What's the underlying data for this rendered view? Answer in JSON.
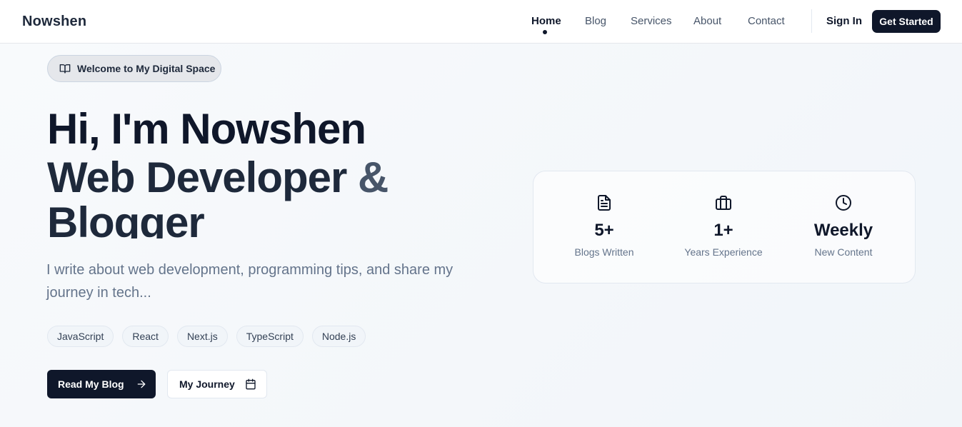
{
  "brand": "Nowshen",
  "nav": {
    "items": [
      {
        "label": "Home",
        "active": true
      },
      {
        "label": "Blog"
      },
      {
        "label": "Services"
      },
      {
        "label": "About"
      },
      {
        "label": "Contact"
      }
    ],
    "sign_in": "Sign In",
    "get_started": "Get Started"
  },
  "hero": {
    "badge": "Welcome to My Digital Space",
    "badge_icon": "book-open-icon",
    "line1": "Hi, I'm Nowshen",
    "line2_main": "Web Developer",
    "line2_amp": "&",
    "line3": "Blogger",
    "description": "I write about web development, programming tips, and share my journey in tech...",
    "tags": [
      "JavaScript",
      "React",
      "Next.js",
      "TypeScript",
      "Node.js"
    ],
    "primary_button": "Read My Blog",
    "primary_icon": "arrow-right-icon",
    "secondary_button": "My Journey",
    "secondary_icon": "calendar-icon"
  },
  "stats": [
    {
      "icon": "document-icon",
      "value": "5+",
      "label": "Blogs Written"
    },
    {
      "icon": "briefcase-icon",
      "value": "1+",
      "label": "Years Experience"
    },
    {
      "icon": "clock-icon",
      "value": "Weekly",
      "label": "New Content"
    }
  ],
  "colors": {
    "primary": "#0f172a",
    "muted": "#64748b",
    "background": "#f8fafc"
  }
}
